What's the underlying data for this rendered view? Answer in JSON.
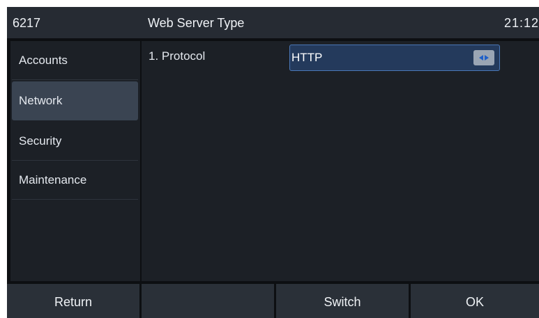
{
  "titlebar": {
    "extension": "6217",
    "title": "Web Server Type",
    "clock": "21:12"
  },
  "sidebar": {
    "items": [
      {
        "label": "Accounts",
        "active": false
      },
      {
        "label": "Network",
        "active": true
      },
      {
        "label": "Security",
        "active": false
      },
      {
        "label": "Maintenance",
        "active": false
      }
    ]
  },
  "content": {
    "fields": [
      {
        "label": "1. Protocol",
        "value": "HTTP",
        "icon": "left-right-arrows-icon"
      }
    ]
  },
  "softkeys": {
    "items": [
      "Return",
      "",
      "Switch",
      "OK"
    ]
  },
  "colors": {
    "screen_bg": "#0d0f12",
    "titlebar_bg": "#262b33",
    "panel_bg": "#1c2026",
    "active_item_bg": "#3a4452",
    "field_bg": "#243a5c",
    "field_border": "#4a78b8",
    "softkey_bg": "#2a3038",
    "arrow_accent": "#1f5fc8"
  }
}
